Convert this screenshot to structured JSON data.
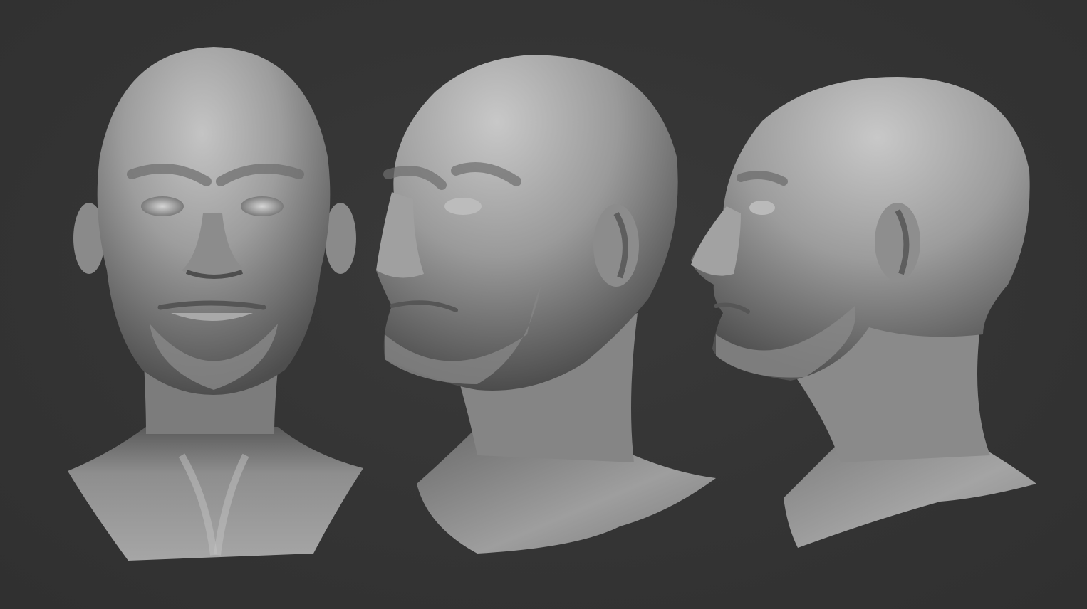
{
  "scene": {
    "background_color": "#333333",
    "clay_color": "#9a9a9a",
    "views": [
      {
        "name": "front-view",
        "kind": "head-sculpt-front"
      },
      {
        "name": "three-quarter-view",
        "kind": "head-sculpt-three-quarter"
      },
      {
        "name": "profile-view",
        "kind": "head-sculpt-profile"
      }
    ]
  }
}
